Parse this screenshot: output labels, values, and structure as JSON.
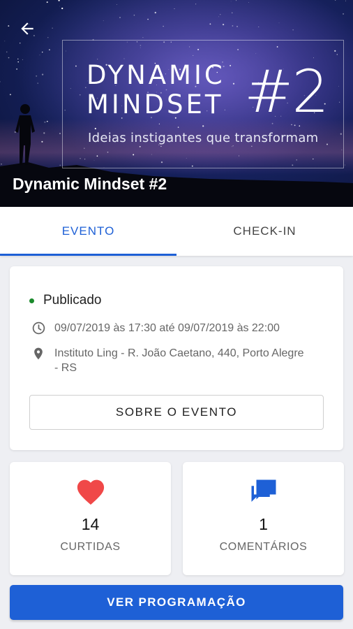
{
  "header": {
    "back_icon": "arrow-left-icon",
    "logo_line1": "DYNAMIC",
    "logo_line2": "MINDSET",
    "logo_number": "#2",
    "tagline": "Ideias instigantes que transformam",
    "title": "Dynamic Mindset #2"
  },
  "tabs": [
    {
      "label": "EVENTO",
      "active": true
    },
    {
      "label": "CHECK-IN",
      "active": false
    }
  ],
  "event": {
    "status": "Publicado",
    "status_color": "#1b8a2c",
    "date_icon": "clock-icon",
    "datetime": "09/07/2019 às 17:30 até 09/07/2019 às 22:00",
    "location_icon": "location-pin-icon",
    "address": "Instituto Ling - R. João Caetano, 440, Porto Alegre - RS",
    "about_button": "SOBRE O EVENTO"
  },
  "stats": {
    "likes": {
      "icon": "heart-icon",
      "count": "14",
      "label": "CURTIDAS",
      "color": "#f04848"
    },
    "comments": {
      "icon": "comments-icon",
      "count": "1",
      "label": "COMENTÁRIOS",
      "color": "#1e60d6"
    }
  },
  "program_button": "VER PROGRAMAÇÃO",
  "accent_color": "#1e60d6"
}
